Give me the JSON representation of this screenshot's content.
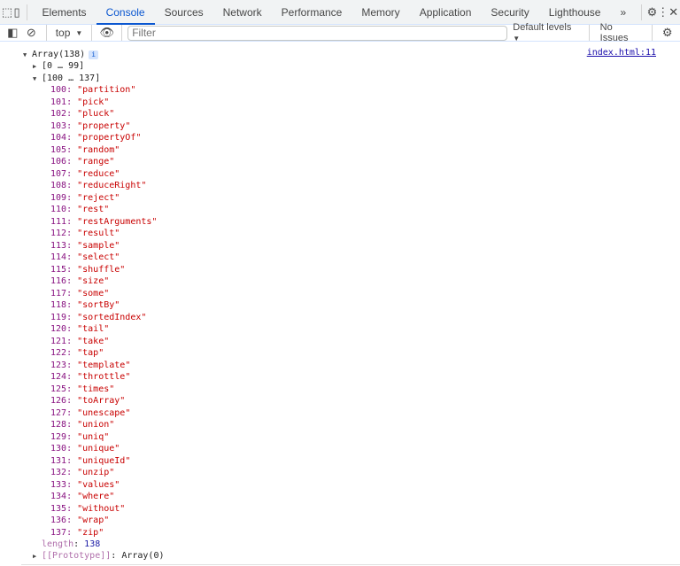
{
  "tabs": [
    "Elements",
    "Console",
    "Sources",
    "Network",
    "Performance",
    "Memory",
    "Application",
    "Security",
    "Lighthouse"
  ],
  "active_tab": "Console",
  "more_tabs": "»",
  "toolbar": {
    "context": "top",
    "filter_placeholder": "Filter",
    "levels": "Default levels",
    "issues": "No Issues"
  },
  "console": {
    "source_link": "index.html:11",
    "array_label": "Array(138)",
    "info_badge": "i",
    "group1": "[0 … 99]",
    "group2": "[100 … 137]",
    "items": [
      [
        "100",
        "partition"
      ],
      [
        "101",
        "pick"
      ],
      [
        "102",
        "pluck"
      ],
      [
        "103",
        "property"
      ],
      [
        "104",
        "propertyOf"
      ],
      [
        "105",
        "random"
      ],
      [
        "106",
        "range"
      ],
      [
        "107",
        "reduce"
      ],
      [
        "108",
        "reduceRight"
      ],
      [
        "109",
        "reject"
      ],
      [
        "110",
        "rest"
      ],
      [
        "111",
        "restArguments"
      ],
      [
        "112",
        "result"
      ],
      [
        "113",
        "sample"
      ],
      [
        "114",
        "select"
      ],
      [
        "115",
        "shuffle"
      ],
      [
        "116",
        "size"
      ],
      [
        "117",
        "some"
      ],
      [
        "118",
        "sortBy"
      ],
      [
        "119",
        "sortedIndex"
      ],
      [
        "120",
        "tail"
      ],
      [
        "121",
        "take"
      ],
      [
        "122",
        "tap"
      ],
      [
        "123",
        "template"
      ],
      [
        "124",
        "throttle"
      ],
      [
        "125",
        "times"
      ],
      [
        "126",
        "toArray"
      ],
      [
        "127",
        "unescape"
      ],
      [
        "128",
        "union"
      ],
      [
        "129",
        "uniq"
      ],
      [
        "130",
        "unique"
      ],
      [
        "131",
        "uniqueId"
      ],
      [
        "132",
        "unzip"
      ],
      [
        "133",
        "values"
      ],
      [
        "134",
        "where"
      ],
      [
        "135",
        "without"
      ],
      [
        "136",
        "wrap"
      ],
      [
        "137",
        "zip"
      ]
    ],
    "length_key": "length",
    "length_value": "138",
    "prototype_key": "[[Prototype]]",
    "prototype_value": "Array(0)"
  }
}
